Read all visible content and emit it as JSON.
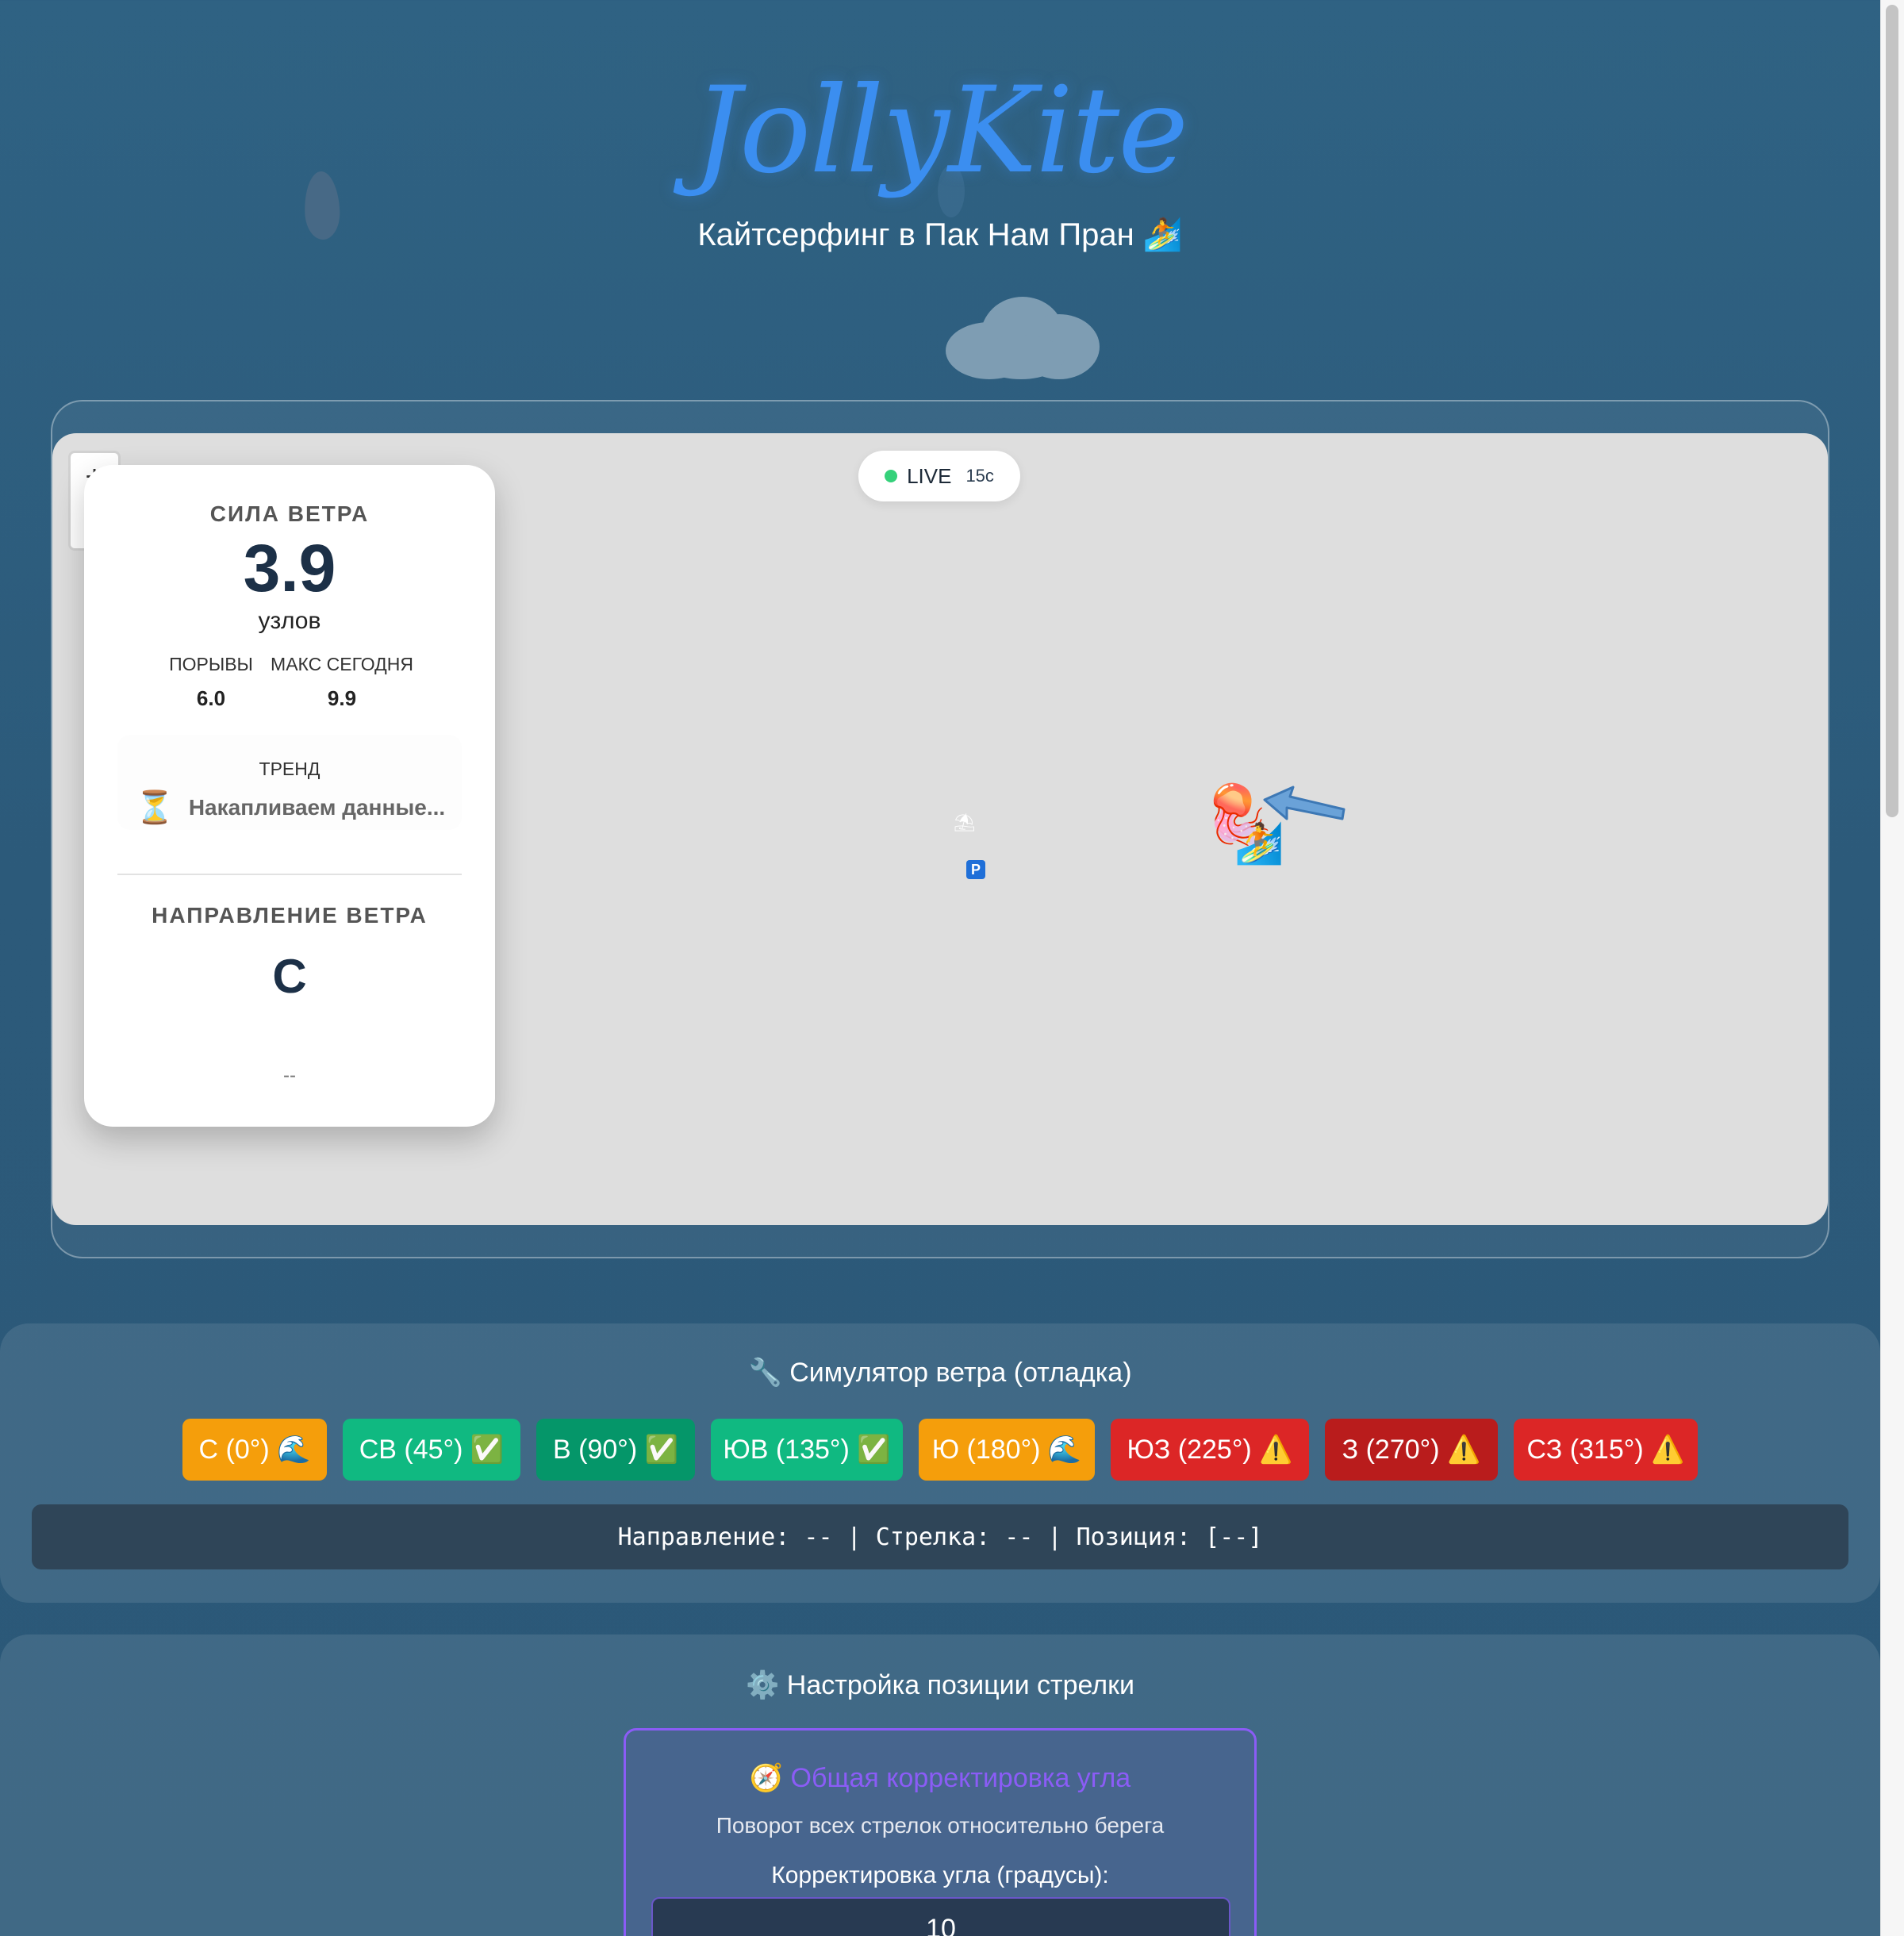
{
  "header": {
    "logo": "JollyKite",
    "subtitle": "Кайтсерфинг в Пак Нам Пран 🏄"
  },
  "map": {
    "live_label": "LIVE",
    "live_timer": "15с",
    "parking_label": "P",
    "beach_icon": "beach-umbrella-icon",
    "jellyfish_icon": "jellyfish-icon",
    "kiter_icon": "kitesurfer-icon"
  },
  "wind": {
    "title": "СИЛА ВЕТРА",
    "speed": "3.9",
    "unit": "узлов",
    "gusts_label": "ПОРЫВЫ",
    "gusts_value": "6.0",
    "max_label": "МАКС СЕГОДНЯ",
    "max_value": "9.9",
    "trend_label": "ТРЕНД",
    "trend_icon": "⏳",
    "trend_text": "Накапливаем данные...",
    "direction_title": "НАПРАВЛЕНИЕ ВЕТРА",
    "direction": "С",
    "degrees": "--"
  },
  "simulator": {
    "title": "🔧 Симулятор ветра (отладка)",
    "buttons": [
      {
        "label": "С (0°) 🌊",
        "color": "#f59e0b"
      },
      {
        "label": "СВ (45°) ✅",
        "color": "#10b981"
      },
      {
        "label": "В (90°) ✅",
        "color": "#059669"
      },
      {
        "label": "ЮВ (135°) ✅",
        "color": "#10b981"
      },
      {
        "label": "Ю (180°) 🌊",
        "color": "#f59e0b"
      },
      {
        "label": "ЮЗ (225°) ⚠️",
        "color": "#dc2626"
      },
      {
        "label": "З (270°) ⚠️",
        "color": "#b91c1c"
      },
      {
        "label": "СЗ (315°) ⚠️",
        "color": "#dc2626"
      }
    ],
    "info": "Направление: -- | Стрелка: -- | Позиция: [--]"
  },
  "settings": {
    "title": "⚙️ Настройка позиции стрелки",
    "angle_title": "🧭 Общая корректировка угла",
    "angle_desc": "Поворот всех стрелок относительно берега",
    "angle_label": "Корректировка угла (градусы):",
    "angle_value": "10"
  },
  "colors": {
    "accent": "#3b8ef0",
    "purple": "#8b5cf6",
    "live_dot": "#35d17a"
  }
}
